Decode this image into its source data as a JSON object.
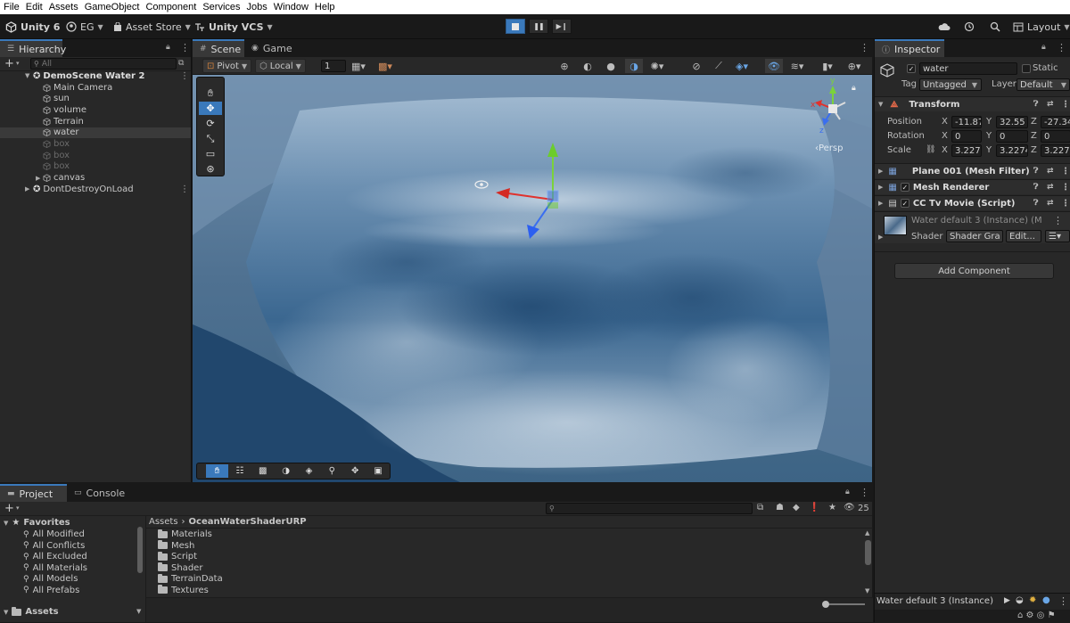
{
  "menubar": {
    "items": [
      "File",
      "Edit",
      "Assets",
      "GameObject",
      "Component",
      "Services",
      "Jobs",
      "Window",
      "Help"
    ]
  },
  "toolbar": {
    "unity_label": "Unity 6",
    "account_label": "EG",
    "asset_store_label": "Asset Store",
    "vcs_label": "Unity VCS",
    "layout_label": "Layout"
  },
  "hierarchy": {
    "tab_label": "Hierarchy",
    "search_placeholder": "All",
    "scene_name": "DemoScene Water 2",
    "items": [
      {
        "label": "Main Camera"
      },
      {
        "label": "sun"
      },
      {
        "label": "volume"
      },
      {
        "label": "Terrain"
      },
      {
        "label": "water"
      },
      {
        "label": "box"
      },
      {
        "label": "box"
      },
      {
        "label": "box"
      },
      {
        "label": "canvas"
      }
    ],
    "ddol_name": "DontDestroyOnLoad"
  },
  "scene": {
    "tabs": [
      "Scene",
      "Game"
    ],
    "pivot_label": "Pivot",
    "local_label": "Local",
    "snap_value": "1",
    "persp_label": "‹Persp",
    "gizmo_axes": {
      "x": "x",
      "y": "y",
      "z": "z"
    }
  },
  "inspector": {
    "tab_label": "Inspector",
    "object_name": "water",
    "static_label": "Static",
    "tag_label": "Tag",
    "tag_value": "Untagged",
    "layer_label": "Layer",
    "layer_value": "Default",
    "transform": {
      "title": "Transform",
      "position_label": "Position",
      "rotation_label": "Rotation",
      "scale_label": "Scale",
      "position": {
        "x": "-11.87",
        "y": "32.55",
        "z": "-27.34"
      },
      "rotation": {
        "x": "0",
        "y": "0",
        "z": "0"
      },
      "scale": {
        "x": "3.2274",
        "y": "3.2274",
        "z": "3.2274"
      }
    },
    "components": [
      {
        "title": "Plane 001 (Mesh Filter)"
      },
      {
        "title": "Mesh Renderer"
      },
      {
        "title": "CC Tv Movie (Script)"
      }
    ],
    "material": {
      "name": "Water default 3 (Instance) (M",
      "shader_label": "Shader",
      "shader_value": "Shader Gra",
      "edit_label": "Edit..."
    },
    "add_component_label": "Add Component",
    "preview_label": "Water default 3 (Instance)"
  },
  "project": {
    "tabs": [
      "Project",
      "Console"
    ],
    "favorites_label": "Favorites",
    "favorites": [
      "All Modified",
      "All Conflicts",
      "All Excluded",
      "All Materials",
      "All Models",
      "All Prefabs"
    ],
    "assets_label": "Assets",
    "breadcrumb": [
      "Assets",
      "OceanWaterShaderURP"
    ],
    "folders": [
      "Materials",
      "Mesh",
      "Script",
      "Shader",
      "TerrainData",
      "Textures"
    ],
    "hidden_count": "25"
  },
  "colors": {
    "accent": "#3a79bb",
    "panel": "#282828",
    "selected": "#3a3a3a",
    "water_deep": "#2c5479",
    "foam": "#dde6ee"
  }
}
